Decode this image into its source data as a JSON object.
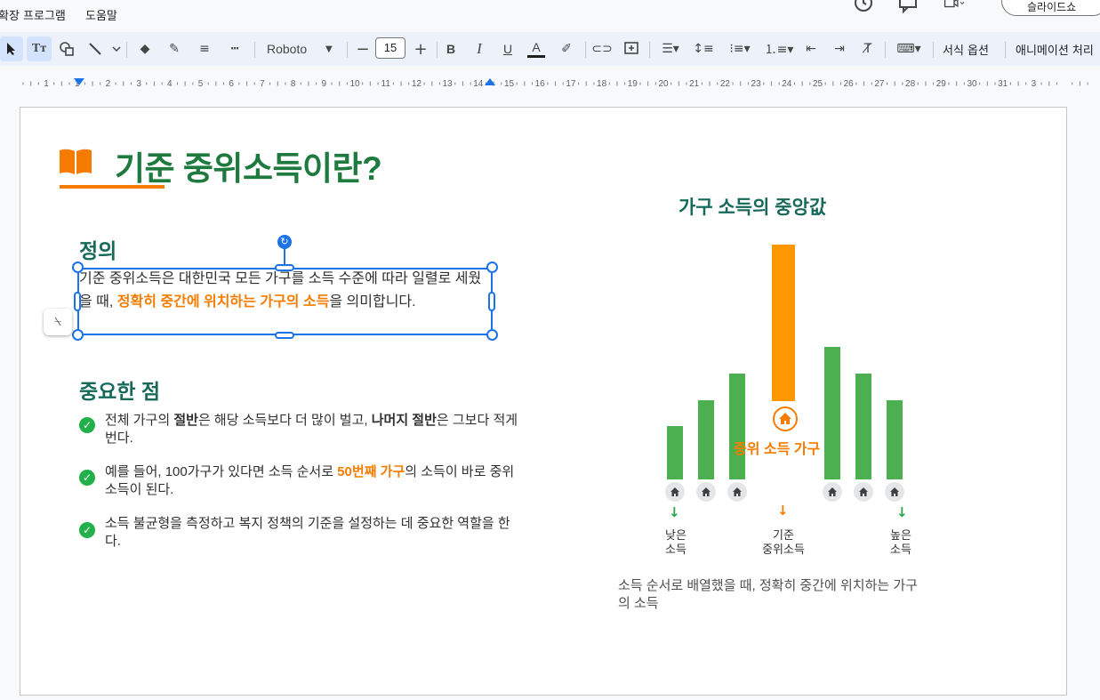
{
  "menu": {
    "items": [
      "확장 프로그램",
      "도움말"
    ],
    "share_label": "슬라이드쇼"
  },
  "toolbar": {
    "font_name": "Roboto",
    "font_size": "15",
    "format_options": "서식 옵션",
    "animation": "애니메이션 처리"
  },
  "ruler": {
    "numbers": [
      "1",
      "1",
      "2",
      "3",
      "4",
      "5",
      "6",
      "7",
      "8",
      "9",
      "10",
      "11",
      "12",
      "13",
      "14",
      "15",
      "16",
      "17",
      "18",
      "19",
      "20",
      "21",
      "22",
      "23",
      "24",
      "25",
      "26",
      "27",
      "28",
      "29",
      "30",
      "31",
      "3"
    ]
  },
  "slide": {
    "title": "기준 중위소득이란?",
    "definition": {
      "heading": "정의",
      "text_before": "기준 중위소득은 대한민국 모든 가구를 소득 수준에 따라 일렬로 세웠을 때, ",
      "text_highlight": "정확히 중간에 위치하는 가구의 소득",
      "text_after": "을 의미합니다."
    },
    "important": {
      "heading": "중요한 점",
      "points": [
        {
          "parts": [
            {
              "t": "전체 가구의 ",
              "s": ""
            },
            {
              "t": "절반",
              "s": "b"
            },
            {
              "t": "은 해당 소득보다 더 많이 벌고, ",
              "s": ""
            },
            {
              "t": "나머지 절반",
              "s": "b"
            },
            {
              "t": "은 그보다 적게 번다.",
              "s": ""
            }
          ]
        },
        {
          "parts": [
            {
              "t": "예를 들어, 100가구가 있다면 소득 순서로 ",
              "s": ""
            },
            {
              "t": "50번째 가구",
              "s": "hl"
            },
            {
              "t": "의 소득이 바로 중위소득이 된다.",
              "s": ""
            }
          ]
        },
        {
          "parts": [
            {
              "t": "소득 불균형을 측정하고 복지 정책의 기준을 설정하는 데 중요한 역할을 한다.",
              "s": ""
            }
          ]
        }
      ]
    },
    "chart": {
      "title": "가구 소득의 중앙값",
      "median_label": "중위 소득 가구",
      "low_label": [
        "낮은",
        "소득"
      ],
      "mid_label": [
        "기준",
        "중위소득"
      ],
      "high_label": [
        "높은",
        "소득"
      ],
      "caption": "소득 순서로 배열했을 때, 정확히 중간에 위치하는 가구의 소득",
      "colors": {
        "green": "#4caf50",
        "orange": "#ff9800",
        "median_text": "#f57c00",
        "arrow_green": "#22a84a"
      }
    }
  }
}
